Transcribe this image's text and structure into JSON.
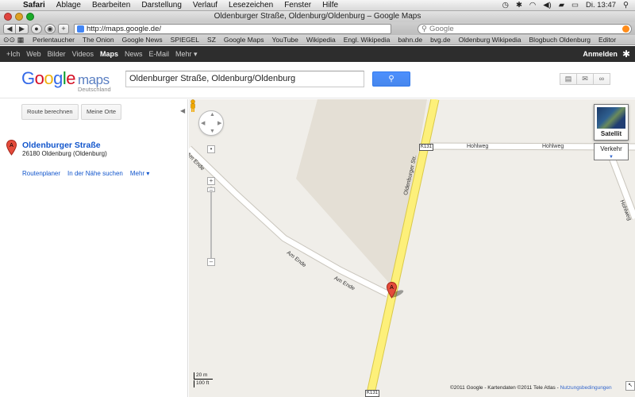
{
  "menubar": {
    "apple": "",
    "app": "Safari",
    "items": [
      "Ablage",
      "Bearbeiten",
      "Darstellung",
      "Verlauf",
      "Lesezeichen",
      "Fenster",
      "Hilfe"
    ],
    "clock": "Di. 13:47"
  },
  "window": {
    "title": "Oldenburger Straße, Oldenburg/Oldenburg – Google Maps"
  },
  "toolbar": {
    "back": "◀",
    "forward": "▶",
    "add": "+",
    "url": "http://maps.google.de/",
    "search_placeholder": "Google"
  },
  "bookmarks": [
    "Perlentaucher",
    "The Onion",
    "Google News",
    "SPIEGEL",
    "SZ",
    "Google Maps",
    "YouTube",
    "Wikipedia",
    "Engl. Wikipedia",
    "bahn.de",
    "bvg.de",
    "Oldenburg Wikipedia",
    "Blogbuch Oldenburg",
    "Editor"
  ],
  "gbar": {
    "items": [
      "+Ich",
      "Web",
      "Bilder",
      "Videos",
      "Maps",
      "News",
      "E-Mail",
      "Mehr ▾"
    ],
    "signin": "Anmelden"
  },
  "header": {
    "logo_g1": "G",
    "logo_o1": "o",
    "logo_o2": "o",
    "logo_g2": "g",
    "logo_l": "l",
    "logo_e": "e",
    "logo_maps": "maps",
    "logo_sub": "Deutschland",
    "query": "Oldenburger Straße, Oldenburg/Oldenburg"
  },
  "panel": {
    "route_button": "Route berechnen",
    "myplaces_button": "Meine Orte",
    "pin_letter": "A",
    "result_title": "Oldenburger Straße",
    "result_address": "26180 Oldenburg (Oldenburg)",
    "links": [
      "Routenplaner",
      "In der Nähe suchen",
      "Mehr ▾"
    ]
  },
  "map": {
    "labels": {
      "oldenburger": "Oldenburger Str.",
      "hohlweg1": "Hohlweg",
      "hohlweg2": "Hohlweg",
      "amende1": "Am Ende",
      "amende2": "Am Ende",
      "amende3": "Am Ende",
      "hohlweg3": "Hohlweg",
      "k131": "K131",
      "k131b": "K131"
    },
    "satellite": "Satellit",
    "traffic": "Verkehr",
    "scale_metric": "20 m",
    "scale_imperial": "100 ft",
    "copyright": "©2011 Google - Kartendaten ©2011 Tele Atlas - ",
    "terms": "Nutzungsbedingungen",
    "marker_letter": "A"
  }
}
